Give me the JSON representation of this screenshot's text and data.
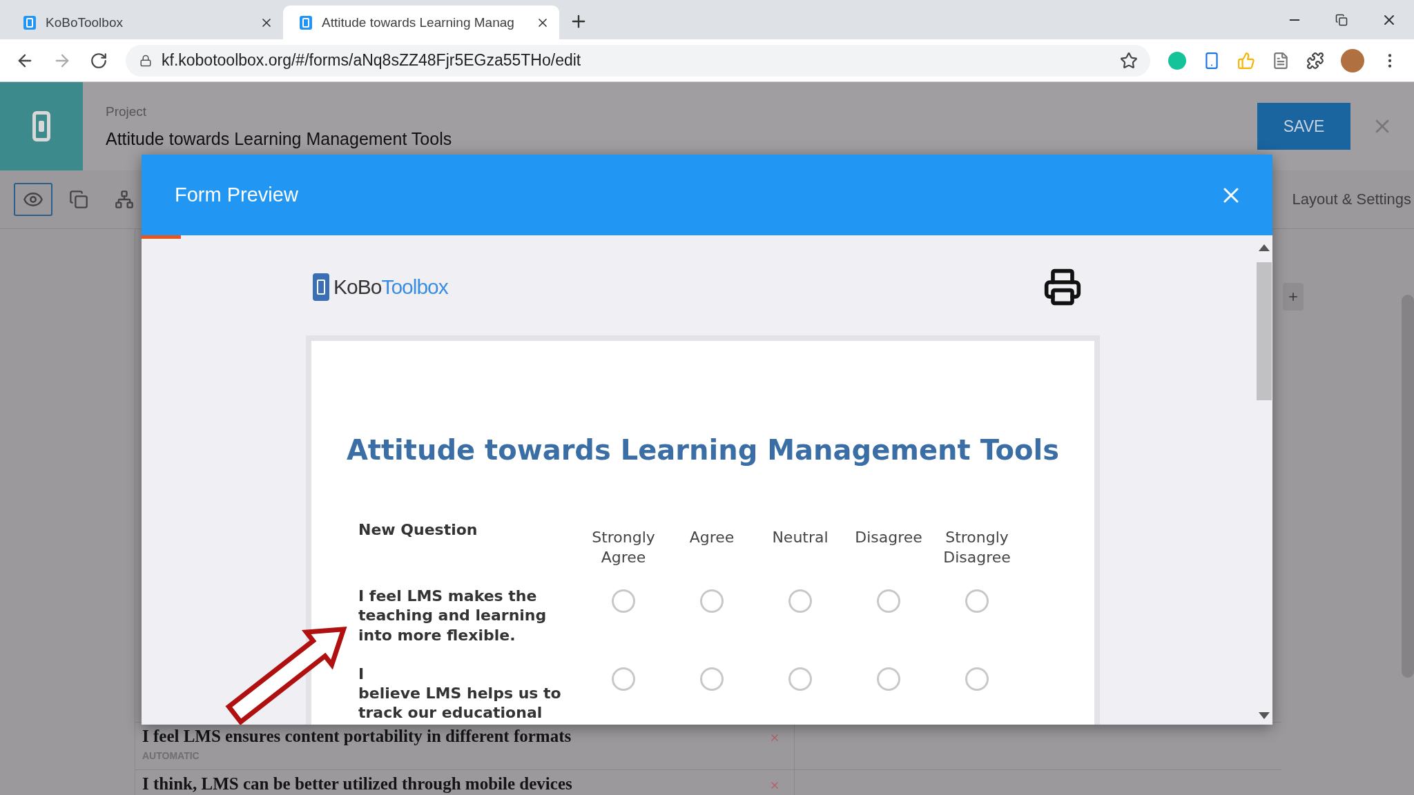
{
  "browser": {
    "tabs": [
      {
        "title": "KoBoToolbox",
        "selected": false
      },
      {
        "title": "Attitude towards Learning Manag",
        "selected": true
      }
    ],
    "address": "kf.kobotoolbox.org/#/forms/aNq8sZZ48Fjr5EGza55THo/edit"
  },
  "header": {
    "label": "Project",
    "title": "Attitude towards Learning Management Tools",
    "save": "SAVE"
  },
  "toolbar": {
    "tools": [
      {
        "kind": "preview",
        "selected": true
      },
      {
        "kind": "copy",
        "selected": false
      },
      {
        "kind": "tree",
        "selected": false
      }
    ],
    "layout_settings": "Layout & Settings"
  },
  "questions": [
    {
      "text": "I feel LMS ensures content portability in different formats",
      "badge": "AUTOMATIC"
    },
    {
      "text": "I think, LMS can be better utilized through mobile devices"
    }
  ],
  "modal": {
    "title": "Form Preview",
    "progress": {
      "level": 0.035
    },
    "logo": {
      "part_1": "KoBo",
      "part_2": "Toolbox"
    },
    "form_title": "Attitude towards Learning Management Tools",
    "matrix": {
      "heading": "New Question",
      "options": [
        "Strongly Agree",
        "Agree",
        "Neutral",
        "Disagree",
        "Strongly Disagree"
      ],
      "rows": [
        {
          "label": "I feel LMS makes the teaching  and learning into more flexible.",
          "choices": [
            {
              "selected": false
            },
            {
              "selected": false
            },
            {
              "selected": false
            },
            {
              "selected": false
            },
            {
              "selected": false
            }
          ]
        },
        {
          "label": "I\nbelieve LMS helps us to track our educational",
          "choices": [
            {
              "selected": false
            },
            {
              "selected": false
            },
            {
              "selected": false
            },
            {
              "selected": false
            },
            {
              "selected": false
            }
          ]
        }
      ]
    }
  }
}
